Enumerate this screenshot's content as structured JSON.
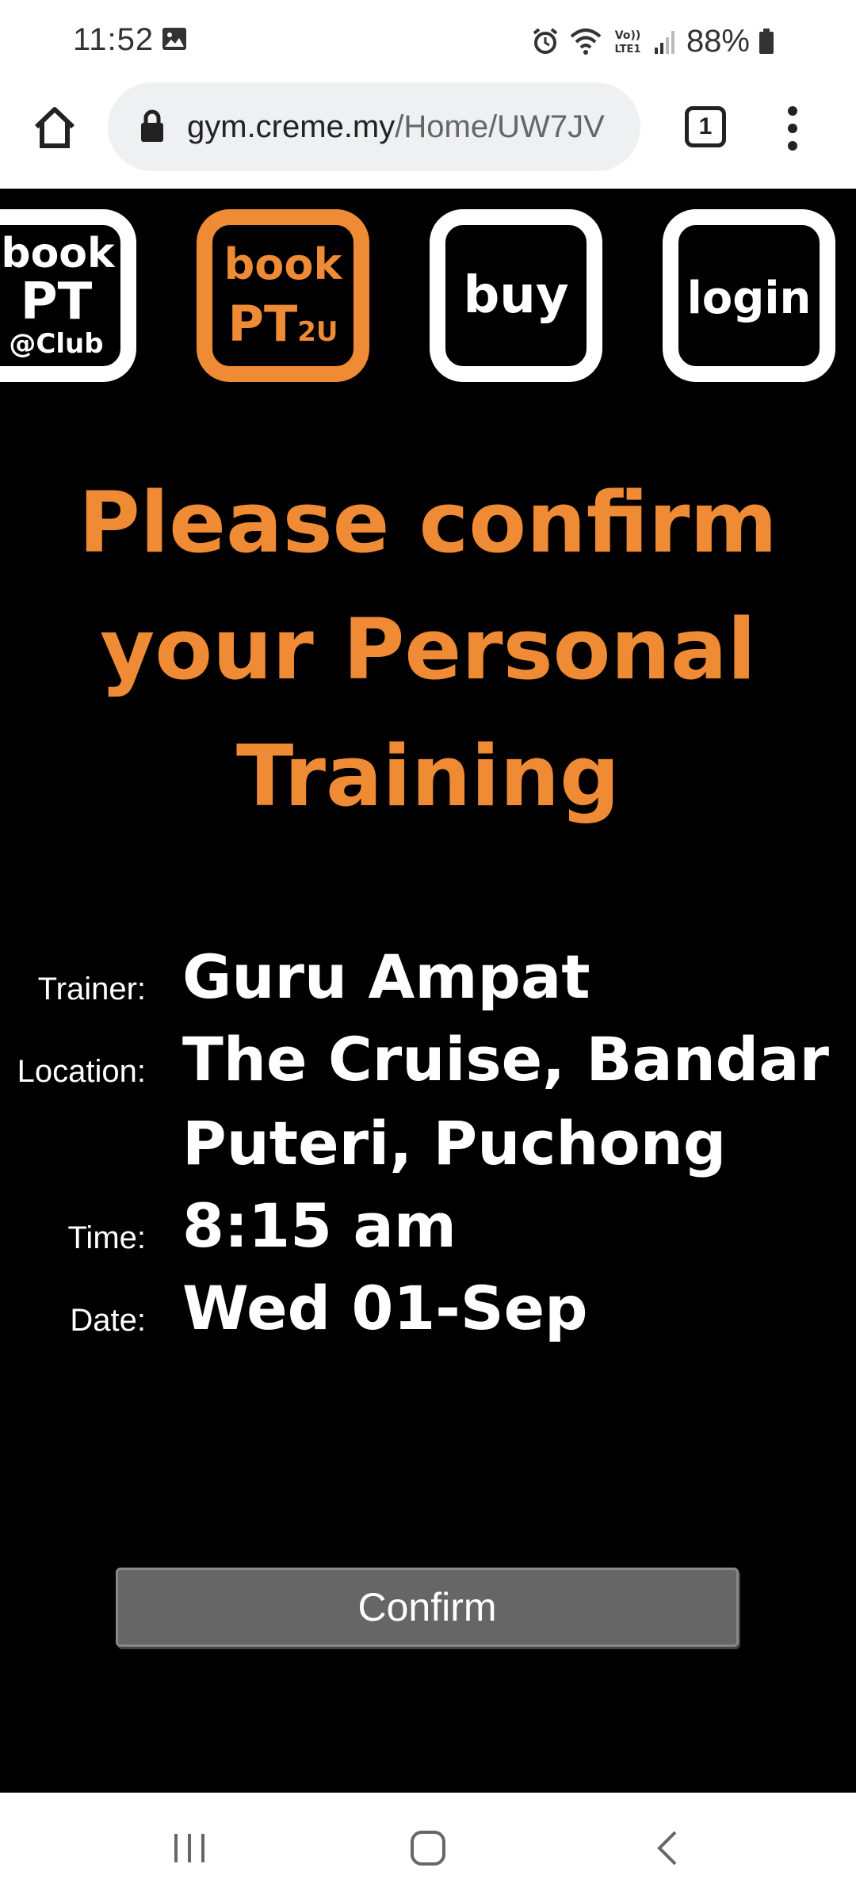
{
  "status_bar": {
    "time": "11:52",
    "battery": "88%",
    "icons": [
      "gallery-icon",
      "alarm-icon",
      "wifi-icon",
      "volte-icon",
      "signal-icon",
      "battery-icon"
    ],
    "volte_label": "Vo)) LTE1"
  },
  "browser": {
    "url_domain": "gym.creme.my",
    "url_path": "/Home/UW7JV",
    "tab_count": "1"
  },
  "nav": {
    "club": {
      "line1": "book",
      "line2": "PT",
      "line3": "@Club"
    },
    "pt2u": {
      "line1": "book",
      "line2": "PT",
      "sub": "2U"
    },
    "buy": "buy",
    "login": "login"
  },
  "heading": "Please confirm your Personal Training",
  "details": {
    "trainer_label": "Trainer:",
    "trainer": "Guru Ampat",
    "location_label": "Location:",
    "location": "The Cruise, Bandar Puteri, Puchong",
    "time_label": "Time:",
    "time": "8:15 am",
    "date_label": "Date:",
    "date": "Wed 01-Sep"
  },
  "confirm_label": "Confirm",
  "colors": {
    "accent": "#ef8a35",
    "background": "#000000",
    "button": "#666666"
  }
}
